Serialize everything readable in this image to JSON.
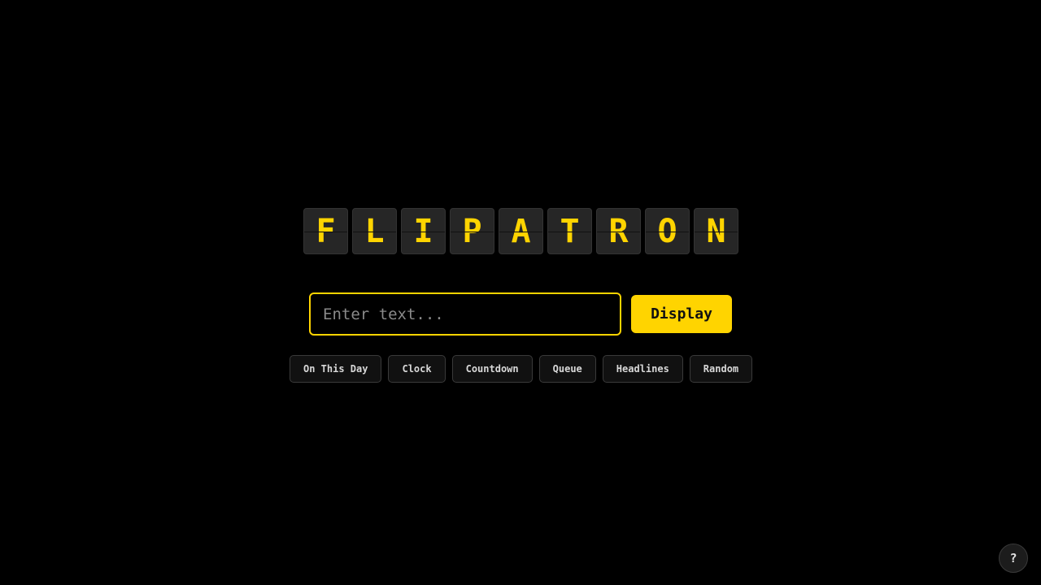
{
  "board": {
    "letters": [
      "F",
      "L",
      "I",
      "P",
      "A",
      "T",
      "R",
      "O",
      "N"
    ]
  },
  "input": {
    "placeholder": "Enter text...",
    "value": ""
  },
  "display_button": {
    "label": "Display"
  },
  "presets": [
    "On This Day",
    "Clock",
    "Countdown",
    "Queue",
    "Headlines",
    "Random"
  ],
  "help_button": {
    "label": "?"
  },
  "colors": {
    "background": "#000000",
    "accent": "#ffd400",
    "tile": "#262626",
    "preset_bg": "#111111"
  }
}
